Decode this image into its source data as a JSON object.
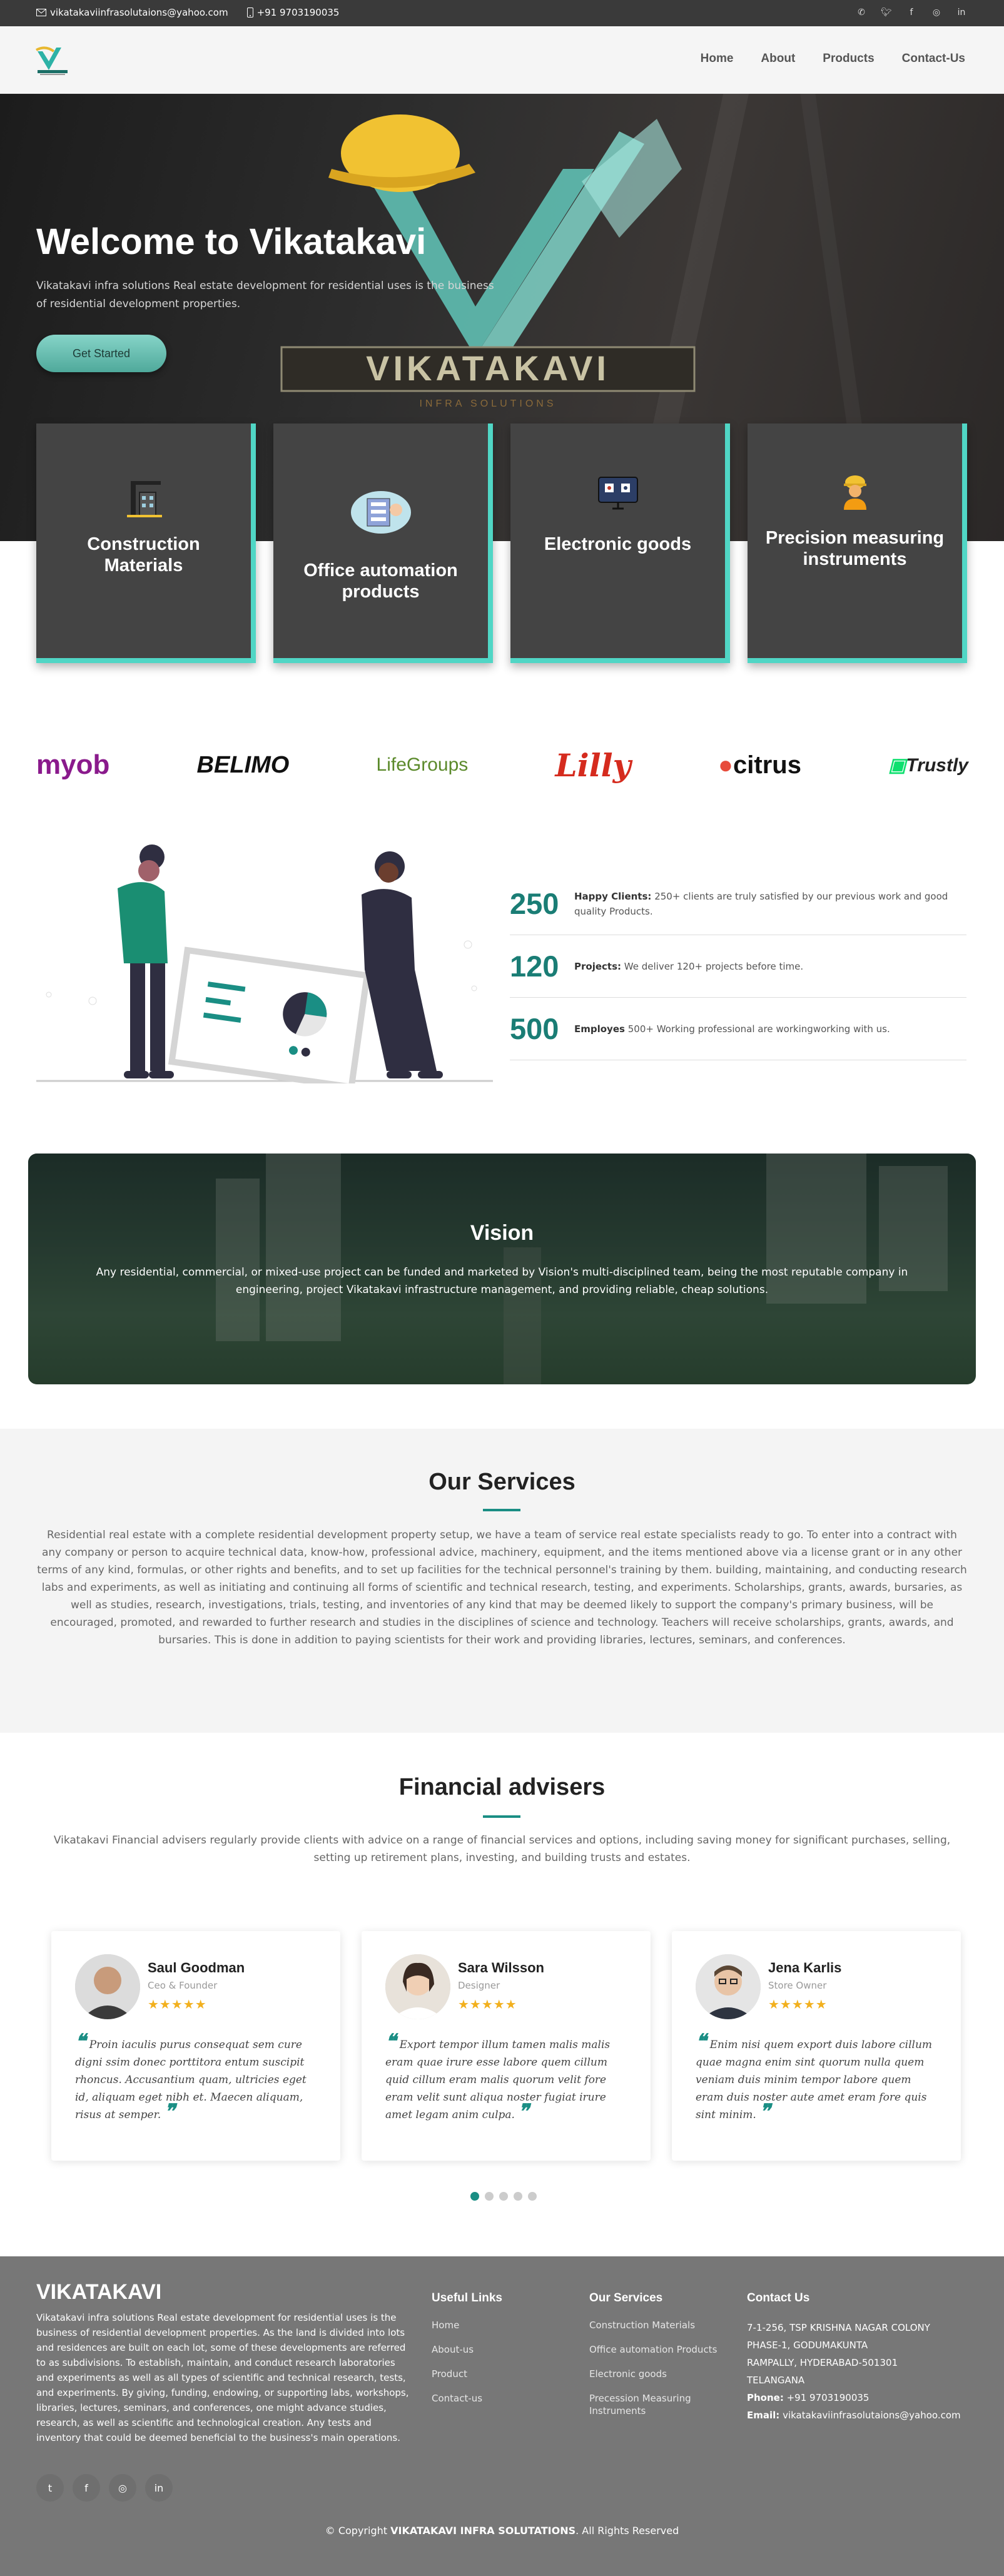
{
  "topbar": {
    "email": "vikatakaviinfrasolutaions@yahoo.com",
    "phone": "+91 9703190035",
    "social_icons": [
      "whatsapp-icon",
      "twitter-icon",
      "facebook-icon",
      "instagram-icon",
      "linkedin-icon"
    ]
  },
  "nav": {
    "home": "Home",
    "about": "About",
    "products": "Products",
    "contact": "Contact-Us"
  },
  "hero": {
    "title": "Welcome to Vikatakavi",
    "text": "Vikatakavi infra solutions Real estate development for residential uses is the business of residential development properties.",
    "cta": "Get Started",
    "sign_text": "VIKATAKAVI",
    "sign_sub": "INFRA SOLUTIONS"
  },
  "cards": [
    {
      "label": "Construction Materials",
      "icon": "construction-icon"
    },
    {
      "label": "Office automation products",
      "icon": "office-icon"
    },
    {
      "label": "Electronic goods",
      "icon": "electronics-icon"
    },
    {
      "label": "Precision measuring instruments",
      "icon": "worker-icon"
    }
  ],
  "brands": [
    "myob",
    "BELIMO",
    "LifeGroups",
    "Lilly",
    "citrus",
    "Trustly"
  ],
  "stats": [
    {
      "num": "250",
      "title": "Happy Clients:",
      "text": "250+ clients are truly satisfied by our previous work and good quality Products."
    },
    {
      "num": "120",
      "title": "Projects:",
      "text": "We deliver 120+ projects before time."
    },
    {
      "num": "500",
      "title": "Employes",
      "text": "500+ Working professional are workingworking with us."
    }
  ],
  "vision": {
    "title": "Vision",
    "text": "Any residential, commercial, or mixed-use project can be funded and marketed by Vision's multi-disciplined team, being the most reputable company in engineering, project Vikatakavi infrastructure management, and providing reliable, cheap solutions."
  },
  "services": {
    "title": "Our Services",
    "text": "Residential real estate with a complete residential development property setup, we have a team of service real estate specialists ready to go. To enter into a contract with any company or person to acquire technical data, know-how, professional advice, machinery, equipment, and the items mentioned above via a license grant or in any other terms of any kind, formulas, or other rights and benefits, and to set up facilities for the technical personnel's training by them. building, maintaining, and conducting research labs and experiments, as well as initiating and continuing all forms of scientific and technical research, testing, and experiments. Scholarships, grants, awards, bursaries, as well as studies, research, investigations, trials, testing, and inventories of any kind that may be deemed likely to support the company's primary business, will be encouraged, promoted, and rewarded to further research and studies in the disciplines of science and technology. Teachers will receive scholarships, grants, awards, and bursaries. This is done in addition to paying scientists for their work and providing libraries, lectures, seminars, and conferences."
  },
  "advisers": {
    "title": "Financial advisers",
    "text": "Vikatakavi Financial advisers regularly provide clients with advice on a range of financial services and options, including saving money for significant purchases, selling, setting up retirement plans, investing, and building trusts and estates.",
    "testimonials": [
      {
        "name": "Saul Goodman",
        "role": "Ceo & Founder",
        "stars": "★★★★★",
        "quote": "Proin iaculis purus consequat sem cure digni ssim donec porttitora entum suscipit rhoncus. Accusantium quam, ultricies eget id, aliquam eget nibh et. Maecen aliquam, risus at semper."
      },
      {
        "name": "Sara Wilsson",
        "role": "Designer",
        "stars": "★★★★★",
        "quote": "Export tempor illum tamen malis malis eram quae irure esse labore quem cillum quid cillum eram malis quorum velit fore eram velit sunt aliqua noster fugiat irure amet legam anim culpa."
      },
      {
        "name": "Jena Karlis",
        "role": "Store Owner",
        "stars": "★★★★★",
        "quote": "Enim nisi quem export duis labore cillum quae magna enim sint quorum nulla quem veniam duis minim tempor labore quem eram duis noster aute amet eram fore quis sint minim."
      }
    ]
  },
  "footer": {
    "brand": "VIKATAKAVI",
    "about": "Vikatakavi infra solutions Real estate development for residential uses is the business of residential development properties. As the land is divided into lots and residences are built on each lot, some of these developments are referred to as subdivisions. To establish, maintain, and conduct research laboratories and experiments as well as all types of scientific and technical research, tests, and experiments. By giving, funding, endowing, or supporting labs, workshops, libraries, lectures, seminars, and conferences, one might advance studies, research, as well as scientific and technological creation. Any tests and inventory that could be deemed beneficial to the business's main operations.",
    "useful_title": "Useful Links",
    "useful_links": [
      "Home",
      "About-us",
      "Product",
      "Contact-us"
    ],
    "services_title": "Our Services",
    "services_links": [
      "Construction Materials",
      "Office automation Products",
      "Electronic goods",
      "Precession Measuring Instruments"
    ],
    "contact_title": "Contact Us",
    "address": [
      "7-1-256, TSP KRISHNA NAGAR COLONY",
      "PHASE-1, GODUMAKUNTA",
      "RAMPALLY, HYDERABAD-501301",
      "TELANGANA"
    ],
    "phone_label": "Phone:",
    "phone": "+91 9703190035",
    "email_label": "Email:",
    "email": "vikatakaviinfrasolutaions@yahoo.com",
    "copyright_pre": "© Copyright",
    "copyright_brand": "VIKATAKAVI INFRA SOLUTATIONS",
    "copyright_post": ". All Rights Reserved"
  },
  "colors": {
    "accent": "#1a8e84",
    "card_border": "#50d6c5",
    "card_bg": "#444444",
    "footer_bg": "#777777"
  }
}
